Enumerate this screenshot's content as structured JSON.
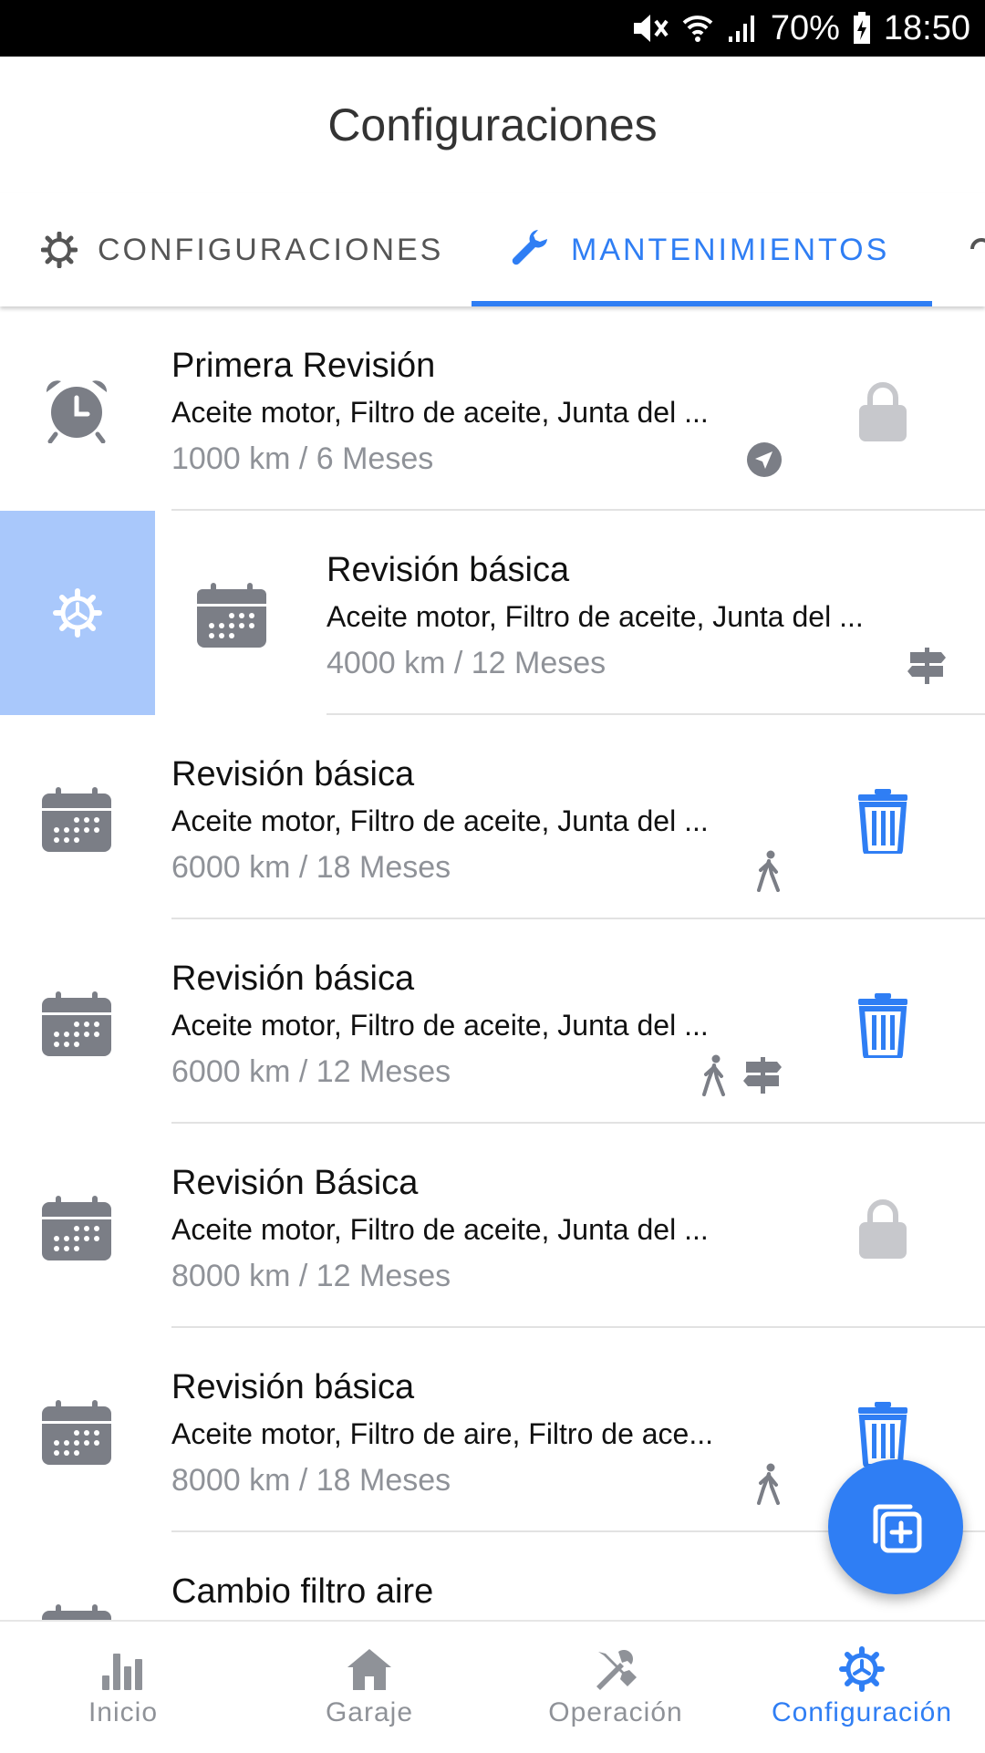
{
  "status_bar": {
    "battery": "70%",
    "time": "18:50"
  },
  "header": {
    "title": "Configuraciones"
  },
  "tabs": [
    {
      "label": "CONFIGURACIONES",
      "icon": "gear-icon",
      "active": false
    },
    {
      "label": "MANTENIMIENTOS",
      "icon": "wrench-icon",
      "active": true
    }
  ],
  "maintenances": [
    {
      "title": "Primera Revisión",
      "parts": "Aceite motor, Filtro de aceite, Junta del ...",
      "interval": "1000 km / 6 Meses",
      "icon": "alarm-clock-icon",
      "flags": [
        "navigation-icon"
      ],
      "action": "lock-icon"
    },
    {
      "title": "Revisión básica",
      "parts": "Aceite motor, Filtro de aceite, Junta del ...",
      "interval": "4000 km / 12 Meses",
      "icon": "calendar-icon",
      "flags": [
        "signpost-icon"
      ],
      "action": "",
      "swipe_action": "settings-icon"
    },
    {
      "title": "Revisión básica",
      "parts": "Aceite motor, Filtro de aceite, Junta del ...",
      "interval": "6000 km / 18 Meses",
      "icon": "calendar-icon",
      "flags": [
        "walking-icon"
      ],
      "action": "trash-icon"
    },
    {
      "title": "Revisión básica",
      "parts": "Aceite motor, Filtro de aceite, Junta del ...",
      "interval": "6000 km / 12 Meses",
      "icon": "calendar-icon",
      "flags": [
        "walking-icon",
        "signpost-icon"
      ],
      "action": "trash-icon"
    },
    {
      "title": "Revisión Básica",
      "parts": "Aceite motor, Filtro de aceite, Junta del ...",
      "interval": "8000 km / 12 Meses",
      "icon": "calendar-icon",
      "flags": [],
      "action": "lock-icon"
    },
    {
      "title": "Revisión básica",
      "parts": "Aceite motor, Filtro de aire, Filtro de ace...",
      "interval": "8000 km / 18 Meses",
      "icon": "calendar-icon",
      "flags": [
        "walking-icon"
      ],
      "action": "trash-icon"
    },
    {
      "title": "Cambio filtro aire",
      "parts": "",
      "interval": "",
      "icon": "calendar-icon",
      "flags": [],
      "action": ""
    }
  ],
  "fab": {
    "icon": "add-copy-icon"
  },
  "bottom_nav": [
    {
      "label": "Inicio",
      "icon": "bar-chart-icon",
      "active": false
    },
    {
      "label": "Garaje",
      "icon": "home-icon",
      "active": false
    },
    {
      "label": "Operación",
      "icon": "tools-icon",
      "active": false
    },
    {
      "label": "Configuración",
      "icon": "gear-icon",
      "active": true
    }
  ],
  "colors": {
    "accent": "#2f7ef4",
    "swipe_bg": "#a9c8fb",
    "icon_gray": "#7b7e86",
    "muted_text": "#8f9298"
  }
}
